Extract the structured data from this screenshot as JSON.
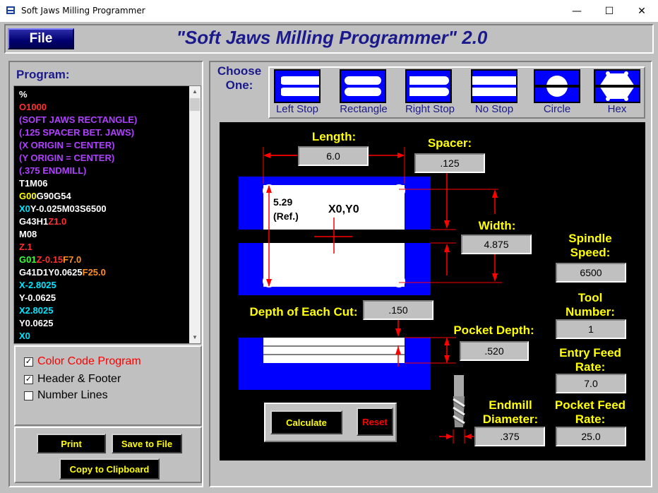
{
  "window": {
    "title": "Soft Jaws Milling Programmer",
    "minimize_glyph": "—",
    "maximize_glyph": "☐",
    "close_glyph": "✕"
  },
  "header": {
    "file_label": "File",
    "app_heading": "\"Soft Jaws Milling Programmer\" 2.0"
  },
  "program": {
    "label": "Program:",
    "lines": [
      [
        {
          "t": "%",
          "c": "#ffffff"
        }
      ],
      [
        {
          "t": "O1000",
          "c": "#ff3030"
        }
      ],
      [
        {
          "t": "(SOFT JAWS RECTANGLE)",
          "c": "#b040ff"
        }
      ],
      [
        {
          "t": "(.125 SPACER BET. JAWS)",
          "c": "#b040ff"
        }
      ],
      [
        {
          "t": "(X ORIGIN = CENTER)",
          "c": "#b040ff"
        }
      ],
      [
        {
          "t": "(Y ORIGIN = CENTER)",
          "c": "#b040ff"
        }
      ],
      [
        {
          "t": "(.375 ENDMILL)",
          "c": "#b040ff"
        }
      ],
      [
        {
          "t": "T1M06",
          "c": "#ffffff"
        }
      ],
      [
        {
          "t": "G00",
          "c": "#ffff00"
        },
        {
          "t": "G90G54",
          "c": "#ffffff"
        }
      ],
      [
        {
          "t": "X0",
          "c": "#00e5ff"
        },
        {
          "t": "Y-0.025M03S6500",
          "c": "#ffffff"
        }
      ],
      [
        {
          "t": "G43H1",
          "c": "#ffffff"
        },
        {
          "t": "Z1.0",
          "c": "#ff3030"
        }
      ],
      [
        {
          "t": "M08",
          "c": "#ffffff"
        }
      ],
      [
        {
          "t": "Z.1",
          "c": "#ff3030"
        }
      ],
      [
        {
          "t": "G01",
          "c": "#40ff40"
        },
        {
          "t": "Z-0.15",
          "c": "#ff3030"
        },
        {
          "t": "F7.0",
          "c": "#ff9020"
        }
      ],
      [
        {
          "t": "G41D1Y0.0625",
          "c": "#ffffff"
        },
        {
          "t": "F25.0",
          "c": "#ff9020"
        }
      ],
      [
        {
          "t": "X-2.8025",
          "c": "#00e5ff"
        }
      ],
      [
        {
          "t": "Y-0.0625",
          "c": "#ffffff"
        }
      ],
      [
        {
          "t": "X2.8025",
          "c": "#00e5ff"
        }
      ],
      [
        {
          "t": "Y0.0625",
          "c": "#ffffff"
        }
      ],
      [
        {
          "t": "X0",
          "c": "#00e5ff"
        }
      ]
    ]
  },
  "options": {
    "color_code": {
      "label": "Color Code Program",
      "checked": true,
      "color": "#ff0000"
    },
    "header_footer": {
      "label": "Header & Footer",
      "checked": true
    },
    "number_lines": {
      "label": "Number Lines",
      "checked": false
    }
  },
  "output_buttons": {
    "print": "Print",
    "save": "Save to File",
    "copy": "Copy to Clipboard"
  },
  "shapes": {
    "choose_label": "Choose One:",
    "items": [
      {
        "label": "Left Stop",
        "icon": "left-stop-icon"
      },
      {
        "label": "Rectangle",
        "icon": "rectangle-icon"
      },
      {
        "label": "Right Stop",
        "icon": "right-stop-icon"
      },
      {
        "label": "No Stop",
        "icon": "no-stop-icon"
      },
      {
        "label": "Circle",
        "icon": "circle-icon"
      },
      {
        "label": "Hex",
        "icon": "hex-icon"
      }
    ]
  },
  "fields": {
    "length": {
      "label": "Length:",
      "value": "6.0"
    },
    "spacer": {
      "label": "Spacer:",
      "value": ".125"
    },
    "width": {
      "label": "Width:",
      "value": "4.875"
    },
    "spindle_speed": {
      "label": "Spindle Speed:",
      "value": "6500"
    },
    "depth_each_cut": {
      "label": "Depth of Each Cut:",
      "value": ".150"
    },
    "tool_number": {
      "label": "Tool Number:",
      "value": "1"
    },
    "pocket_depth": {
      "label": "Pocket Depth:",
      "value": ".520"
    },
    "entry_feed": {
      "label": "Entry Feed Rate:",
      "value": "7.0"
    },
    "endmill_diameter": {
      "label": "Endmill Diameter:",
      "value": ".375"
    },
    "pocket_feed": {
      "label": "Pocket Feed Rate:",
      "value": "25.0"
    }
  },
  "drawing": {
    "ref_dim": "5.29",
    "ref_note": "(Ref.)",
    "origin_label": "X0,Y0"
  },
  "actions": {
    "calculate": "Calculate",
    "reset": "Reset"
  },
  "colors": {
    "jaw_blue": "#0000ff",
    "dim_red": "#ff0000",
    "label_yellow": "#ffff00",
    "heading_navy": "#1a1a8c"
  }
}
